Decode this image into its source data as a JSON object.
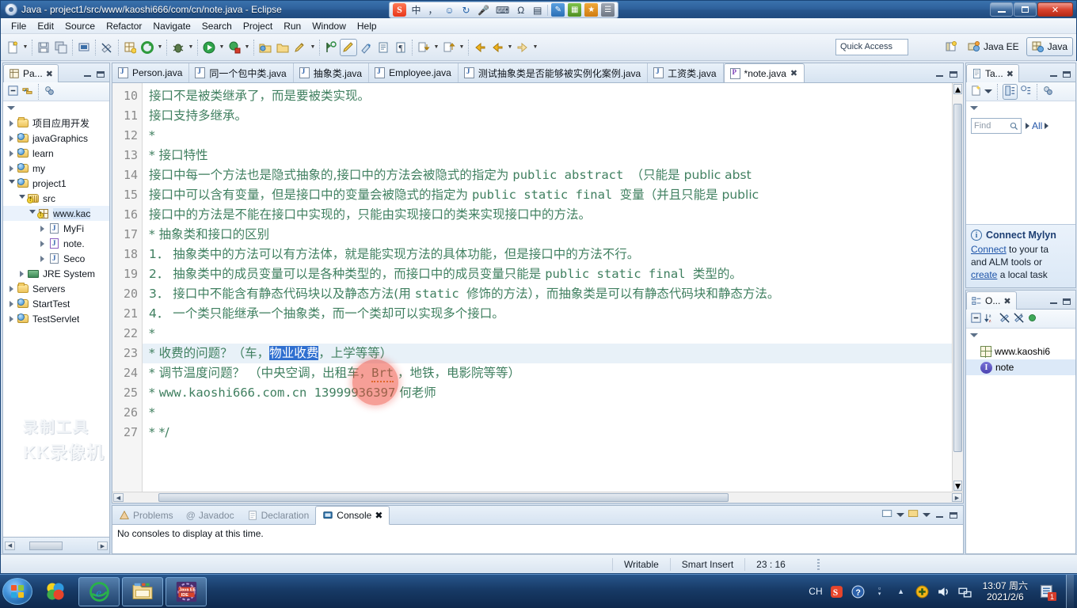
{
  "window": {
    "title": "Java - project1/src/www/kaoshi666/com/cn/note.java - Eclipse",
    "icon": "eclipse-icon",
    "minimize": "–",
    "maximize": "❐",
    "close": "✕"
  },
  "ime": {
    "logo": "S",
    "items": [
      "中",
      "、",
      "↺",
      "🎤",
      "⌨",
      "Ω",
      "📅",
      "🔍",
      "⚙",
      "■",
      "■"
    ]
  },
  "menu": [
    "File",
    "Edit",
    "Source",
    "Refactor",
    "Navigate",
    "Search",
    "Project",
    "Run",
    "Window",
    "Help"
  ],
  "toolbar": {
    "quick_access_placeholder": "Quick Access",
    "perspective_java_ee": "Java EE",
    "perspective_java": "Java",
    "open_perspective_icon": "open-perspective-icon"
  },
  "package_explorer": {
    "tab_label": "Pa...",
    "close_icon": "✖",
    "tree": [
      {
        "label": "项目应用开发",
        "depth": 0,
        "icon": "folder",
        "arrow": "closed"
      },
      {
        "label": "javaGraphics",
        "depth": 0,
        "icon": "project",
        "arrow": "closed"
      },
      {
        "label": "learn",
        "depth": 0,
        "icon": "project",
        "arrow": "closed"
      },
      {
        "label": "my",
        "depth": 0,
        "icon": "project",
        "arrow": "closed"
      },
      {
        "label": "project1",
        "depth": 0,
        "icon": "project",
        "arrow": "open"
      },
      {
        "label": "src",
        "depth": 1,
        "icon": "src",
        "arrow": "open"
      },
      {
        "label": "www.kac",
        "depth": 2,
        "icon": "package",
        "arrow": "open",
        "selected": true
      },
      {
        "label": "MyFi",
        "depth": 3,
        "icon": "java",
        "arrow": "closed"
      },
      {
        "label": "note.",
        "depth": 3,
        "icon": "java-purple",
        "arrow": "closed"
      },
      {
        "label": "Seco",
        "depth": 3,
        "icon": "java",
        "arrow": "closed"
      },
      {
        "label": "JRE System",
        "depth": 1,
        "icon": "jre",
        "arrow": "closed"
      },
      {
        "label": "Servers",
        "depth": 0,
        "icon": "folder",
        "arrow": "closed"
      },
      {
        "label": "StartTest",
        "depth": 0,
        "icon": "project",
        "arrow": "closed"
      },
      {
        "label": "TestServlet",
        "depth": 0,
        "icon": "project",
        "arrow": "closed"
      }
    ]
  },
  "editor": {
    "tabs": [
      {
        "label": "Person.java",
        "active": false,
        "dirty": false
      },
      {
        "label": "同一个包中类.java",
        "active": false,
        "dirty": false
      },
      {
        "label": "抽象类.java",
        "active": false,
        "dirty": false
      },
      {
        "label": "Employee.java",
        "active": false,
        "dirty": false
      },
      {
        "label": "测试抽象类是否能够被实例化案例.java",
        "active": false,
        "dirty": false
      },
      {
        "label": "工资类.java",
        "active": false,
        "dirty": false
      },
      {
        "label": "*note.java",
        "active": true,
        "dirty": true,
        "close_icon": "✖"
      }
    ],
    "first_line_number": 10,
    "line_numbers": [
      10,
      11,
      12,
      13,
      14,
      15,
      16,
      17,
      18,
      19,
      20,
      21,
      22,
      23,
      24,
      25,
      26,
      27
    ],
    "lines": [
      {
        "n": 10,
        "text": "接口不是被类继承了，而是要被类实现。"
      },
      {
        "n": 11,
        "text": "接口支持多继承。"
      },
      {
        "n": 12,
        "text": "*"
      },
      {
        "n": 13,
        "text": "  *  接口特性"
      },
      {
        "n": 14,
        "text": "接口中每一个方法也是隐式抽象的,接口中的方法会被隐式的指定为 ",
        "mono": "public  abstract ",
        "tail": "（只能是 public  abst"
      },
      {
        "n": 15,
        "text": "接口中可以含有变量，但是接口中的变量会被隐式的指定为 ",
        "mono": "public  static  final ",
        "tail": "变量（并且只能是 public"
      },
      {
        "n": 16,
        "text": "接口中的方法是不能在接口中实现的，只能由实现接口的类来实现接口中的方法。"
      },
      {
        "n": 17,
        "text": "  *  抽象类和接口的区别"
      },
      {
        "n": 18,
        "text": "1． 抽象类中的方法可以有方法体，就是能实现方法的具体功能，但是接口中的方法不行。"
      },
      {
        "n": 19,
        "text": "2． 抽象类中的成员变量可以是各种类型的，而接口中的成员变量只能是 ",
        "mono": "public  static  final ",
        "tail": "类型的。"
      },
      {
        "n": 20,
        "text": "3． 接口中不能含有静态代码块以及静态方法(用 ",
        "mono": "static ",
        "tail": " 修饰的方法），而抽象类是可以有静态代码块和静态方法。"
      },
      {
        "n": 21,
        "text": "4． 一个类只能继承一个抽象类，而一个类却可以实现多个接口。"
      },
      {
        "n": 22,
        "text": " *"
      },
      {
        "n": 23,
        "text": " *  收费的问题？（车，",
        "selected": "物业收费",
        "tail": "，上学等等）",
        "highlight": true
      },
      {
        "n": 24,
        "text": " *  调节温度问题？ （中央空调，出租车，",
        "mono": "Brt",
        "tail": " ，地铁，电影院等等）"
      },
      {
        "n": 25,
        "text": " *  ",
        "mono": "www.kaoshi666.com.cn   13999936397",
        "tail": "   何老师"
      },
      {
        "n": 26,
        "text": " *"
      },
      {
        "n": 27,
        "text": " *  */"
      }
    ]
  },
  "console": {
    "tabs": [
      {
        "label": "Problems",
        "active": false,
        "icon": "problems-icon"
      },
      {
        "label": "Javadoc",
        "active": false,
        "icon": "javadoc-icon"
      },
      {
        "label": "Declaration",
        "active": false,
        "icon": "declaration-icon"
      },
      {
        "label": "Console",
        "active": true,
        "icon": "console-icon",
        "close_icon": "✖"
      }
    ],
    "message": "No consoles to display at this time."
  },
  "task_list": {
    "tab_label": "Ta...",
    "close_icon": "✖",
    "find_placeholder": "Find",
    "all_label": "All",
    "mylyn": {
      "title": "Connect Mylyn",
      "line1_link": "Connect",
      "line1_rest": " to your ta",
      "line2": "and ALM tools or",
      "line3_link": "create",
      "line3_rest": " a local task"
    }
  },
  "outline": {
    "tab_label": "O...",
    "close_icon": "✖",
    "items": [
      {
        "label": "www.kaoshi6",
        "icon": "package-icon"
      },
      {
        "label": "note",
        "icon": "interface-icon",
        "selected": true
      }
    ]
  },
  "status_bar": {
    "writable": "Writable",
    "insert_mode": "Smart Insert",
    "position": "23 : 16"
  },
  "watermark": {
    "line1": "录制工具",
    "line2": "KK录像机"
  },
  "taskbar": {
    "start": "start-orb",
    "items": [
      {
        "name": "sogou-taskbar-icon",
        "boxed": false
      },
      {
        "name": "internet-explorer-icon",
        "boxed": true
      },
      {
        "name": "file-explorer-icon",
        "boxed": true
      },
      {
        "name": "java-ee-ide-icon",
        "boxed": true,
        "label": "Java EE IDE"
      }
    ],
    "tray": {
      "lang": "CH",
      "icons": [
        "sogou-ime-icon",
        "help-icon",
        "show-hidden-icon"
      ],
      "status_icons": [
        "update-icon",
        "volume-icon",
        "network-icon"
      ],
      "time": "13:07 周六",
      "date": "2021/2/6",
      "notification_count": "1"
    }
  }
}
